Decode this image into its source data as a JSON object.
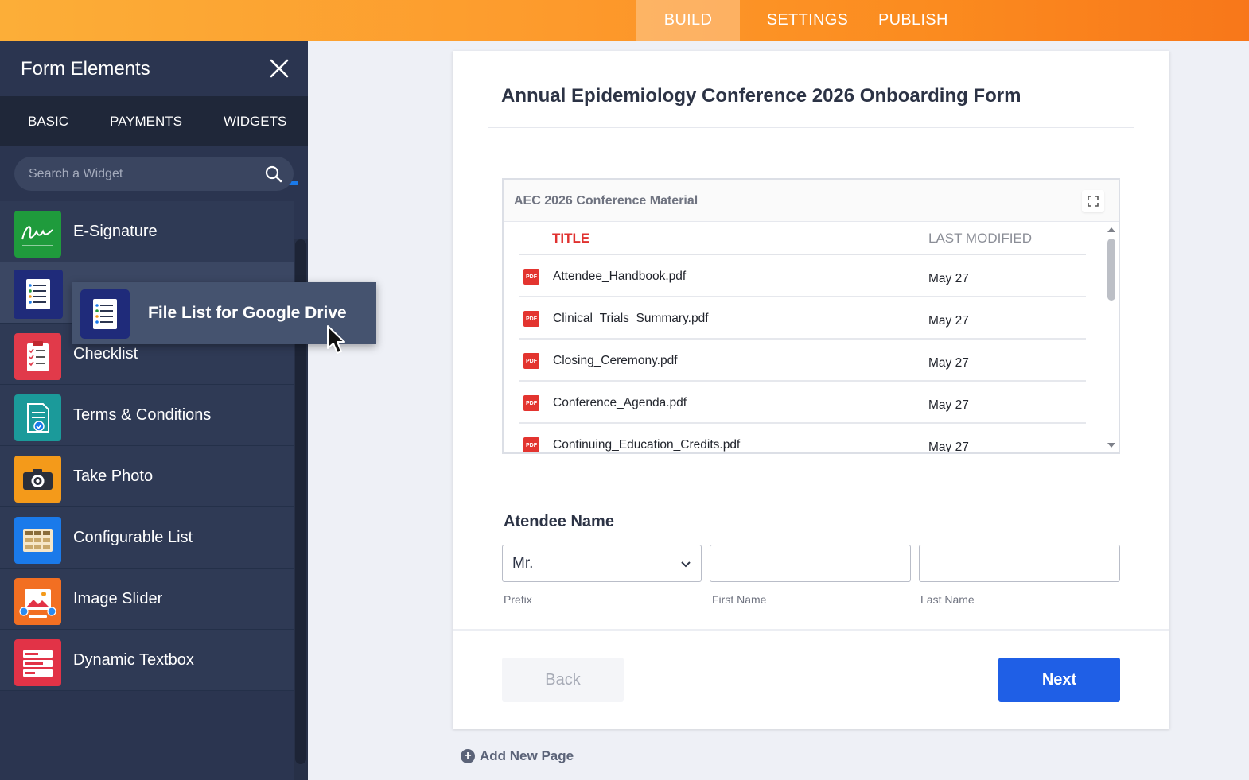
{
  "top_nav": {
    "tabs": [
      {
        "label": "BUILD",
        "active": true
      },
      {
        "label": "SETTINGS",
        "active": false
      },
      {
        "label": "PUBLISH",
        "active": false
      }
    ],
    "accent": "#fd9a2c"
  },
  "sidebar": {
    "title": "Form Elements",
    "close_icon": "close-icon",
    "tabs": [
      {
        "label": "BASIC"
      },
      {
        "label": "PAYMENTS"
      },
      {
        "label": "WIDGETS",
        "active": true
      }
    ],
    "search": {
      "placeholder": "Search a Widget",
      "value": ""
    },
    "items": [
      {
        "label": "E-Signature",
        "icon": "signature-icon",
        "color": "#1f9b3c"
      },
      {
        "label": "",
        "icon": "file-list-icon",
        "color": "#1f2b7a"
      },
      {
        "label": "Checklist",
        "icon": "checklist-icon",
        "color": "#e13a4a"
      },
      {
        "label": "Terms & Conditions",
        "icon": "document-check-icon",
        "color": "#1b9a9a"
      },
      {
        "label": "Take Photo",
        "icon": "camera-icon",
        "color": "#f49a1a"
      },
      {
        "label": "Configurable List",
        "icon": "grid-list-icon",
        "color": "#1a7aea"
      },
      {
        "label": "Image Slider",
        "icon": "image-slider-icon",
        "color": "#f26f22"
      },
      {
        "label": "Dynamic Textbox",
        "icon": "textbox-icon",
        "color": "#e23347"
      }
    ]
  },
  "drag_ghost": {
    "label": "File List for Google Drive",
    "icon": "file-list-icon"
  },
  "form": {
    "title": "Annual Epidemiology Conference 2026 Onboarding Form",
    "widget": {
      "title": "AEC 2026 Conference Material",
      "columns": {
        "title": "TITLE",
        "modified": "LAST MODIFIED"
      },
      "files": [
        {
          "name": "Attendee_Handbook.pdf",
          "modified": "May 27"
        },
        {
          "name": "Clinical_Trials_Summary.pdf",
          "modified": "May 27"
        },
        {
          "name": "Closing_Ceremony.pdf",
          "modified": "May 27"
        },
        {
          "name": "Conference_Agenda.pdf",
          "modified": "May 27"
        },
        {
          "name": "Continuing_Education_Credits.pdf",
          "modified": "May 27"
        }
      ],
      "pdf_badge": "PDF"
    },
    "name_field": {
      "label": "Atendee Name",
      "prefix_value": "Mr.",
      "first_value": "",
      "last_value": "",
      "sublabels": {
        "prefix": "Prefix",
        "first": "First Name",
        "last": "Last Name"
      }
    },
    "buttons": {
      "back": "Back",
      "next": "Next"
    }
  },
  "add_page": {
    "label": "Add New Page",
    "icon": "plus-circle-icon"
  }
}
